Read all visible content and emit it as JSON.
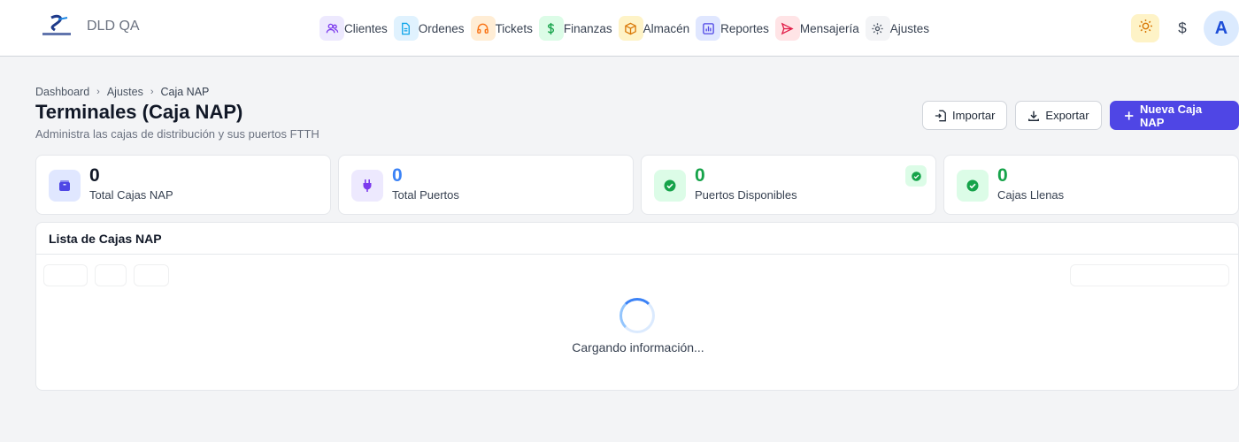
{
  "app": {
    "brand": "DLD QA"
  },
  "nav": {
    "items": [
      {
        "label": "Clientes",
        "icon": "users-icon",
        "bg": "#ede9fe",
        "color": "#7c3aed"
      },
      {
        "label": "Ordenes",
        "icon": "document-icon",
        "bg": "#e0f2fe",
        "color": "#0ea5e9"
      },
      {
        "label": "Tickets",
        "icon": "headset-icon",
        "bg": "#ffedd5",
        "color": "#f97316"
      },
      {
        "label": "Finanzas",
        "icon": "dollar-icon",
        "bg": "#dcfce7",
        "color": "#16a34a"
      },
      {
        "label": "Almacén",
        "icon": "box-icon",
        "bg": "#fef3c7",
        "color": "#d97706"
      },
      {
        "label": "Reportes",
        "icon": "chart-icon",
        "bg": "#e0e7ff",
        "color": "#4f46e5"
      },
      {
        "label": "Mensajería",
        "icon": "send-icon",
        "bg": "#ffe4e6",
        "color": "#e11d48"
      },
      {
        "label": "Ajustes",
        "icon": "gear-icon",
        "bg": "#f3f4f6",
        "color": "#4b5563"
      }
    ]
  },
  "user": {
    "avatar_letter": "A",
    "currency_symbol": "$"
  },
  "breadcrumb": {
    "items": [
      "Dashboard",
      "Ajustes",
      "Caja NAP"
    ]
  },
  "page": {
    "title": "Terminales (Caja NAP)",
    "subtitle": "Administra las cajas de distribución y sus puertos FTTH"
  },
  "actions": {
    "import_label": "Importar",
    "export_label": "Exportar",
    "new_label": "Nueva Caja NAP"
  },
  "stats": [
    {
      "value": "0",
      "label": "Total Cajas NAP",
      "value_color": "#111827",
      "icon": "box-icon",
      "icon_bg": "#e0e7ff",
      "icon_color": "#4f46e5"
    },
    {
      "value": "0",
      "label": "Total Puertos",
      "value_color": "#3b82f6",
      "icon": "plug-icon",
      "icon_bg": "#ede9fe",
      "icon_color": "#7c3aed"
    },
    {
      "value": "0",
      "label": "Puertos Disponibles",
      "value_color": "#16a34a",
      "icon": "check-circle-icon",
      "icon_bg": "#dcfce7",
      "icon_color": "#16a34a"
    },
    {
      "value": "0",
      "label": "Cajas Llenas",
      "value_color": "#16a34a",
      "icon": "check-circle-icon",
      "icon_bg": "#dcfce7",
      "icon_color": "#16a34a"
    }
  ],
  "list": {
    "title": "Lista de Cajas NAP",
    "loading_text": "Cargando información..."
  }
}
